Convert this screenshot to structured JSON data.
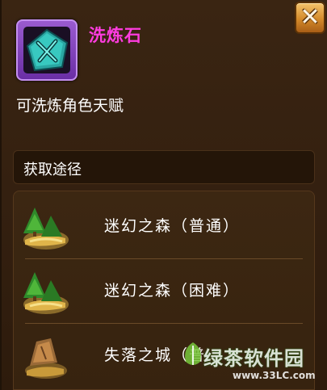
{
  "item": {
    "name": "洗炼石",
    "description": "可洗炼角色天赋",
    "rarity_color": "#ff3ce0"
  },
  "close_button": {
    "icon": "close-icon"
  },
  "sources_section": {
    "title": "获取途径"
  },
  "sources": [
    {
      "label": "迷幻之森（普通）",
      "icon": "forest-scene-icon"
    },
    {
      "label": "迷幻之森（困难）",
      "icon": "forest-scene-icon"
    },
    {
      "label": "失落之城（普",
      "icon": "rock-scene-icon"
    }
  ],
  "watermark": {
    "text": "绿茶软件园",
    "url": "www.33LC.com"
  }
}
